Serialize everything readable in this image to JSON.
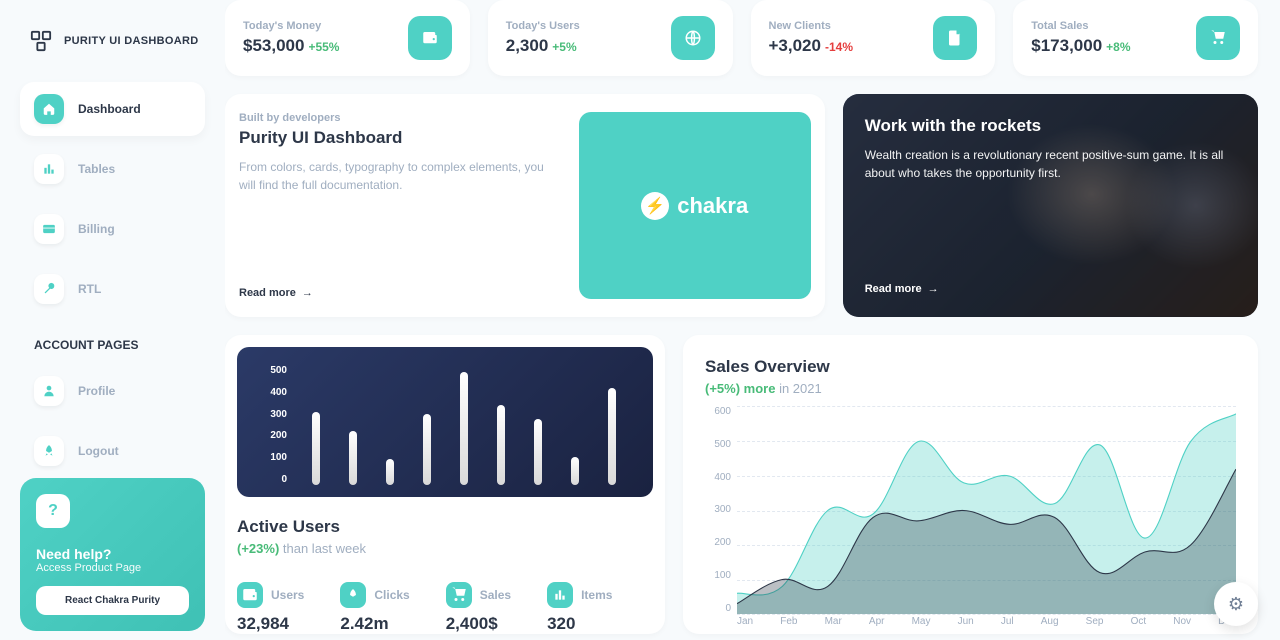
{
  "brand": "PURITY UI DASHBOARD",
  "nav": {
    "items": [
      {
        "label": "Dashboard",
        "icon": "home-icon"
      },
      {
        "label": "Tables",
        "icon": "stats-icon"
      },
      {
        "label": "Billing",
        "icon": "card-icon"
      },
      {
        "label": "RTL",
        "icon": "wrench-icon"
      }
    ],
    "account_heading": "ACCOUNT PAGES",
    "account_items": [
      {
        "label": "Profile",
        "icon": "person-icon"
      },
      {
        "label": "Logout",
        "icon": "rocket-icon"
      }
    ]
  },
  "help": {
    "title": "Need help?",
    "subtitle": "Access Product Page",
    "button": "React Chakra Purity"
  },
  "stats": [
    {
      "label": "Today's Money",
      "value": "$53,000",
      "delta": "+55%",
      "delta_sign": "pos",
      "icon": "wallet-icon"
    },
    {
      "label": "Today's Users",
      "value": "2,300",
      "delta": "+5%",
      "delta_sign": "pos",
      "icon": "globe-icon"
    },
    {
      "label": "New Clients",
      "value": "+3,020",
      "delta": "-14%",
      "delta_sign": "neg",
      "icon": "document-icon"
    },
    {
      "label": "Total Sales",
      "value": "$173,000",
      "delta": "+8%",
      "delta_sign": "pos",
      "icon": "cart-icon"
    }
  ],
  "intro": {
    "pre": "Built by developers",
    "title": "Purity UI Dashboard",
    "body": "From colors, cards, typography to complex elements, you will find the full documentation.",
    "read_more": "Read more",
    "brand_word": "chakra"
  },
  "rocket": {
    "title": "Work with the rockets",
    "body": "Wealth creation is a revolutionary recent positive-sum game. It is all about who takes the opportunity first.",
    "read_more": "Read more"
  },
  "active": {
    "title": "Active Users",
    "delta": "(+23%)",
    "subtitle_rest": " than last week",
    "mini": [
      {
        "label": "Users",
        "value": "32,984",
        "icon": "wallet-icon"
      },
      {
        "label": "Clicks",
        "value": "2.42m",
        "icon": "rocket-icon"
      },
      {
        "label": "Sales",
        "value": "2,400$",
        "icon": "cart-icon"
      },
      {
        "label": "Items",
        "value": "320",
        "icon": "stats-icon"
      }
    ]
  },
  "sales": {
    "title": "Sales Overview",
    "delta": "(+5%) more",
    "subtitle_rest": " in 2021"
  },
  "chart_data": [
    {
      "type": "bar",
      "values": [
        310,
        230,
        110,
        300,
        480,
        340,
        280,
        120,
        410
      ],
      "ylim": [
        0,
        500
      ],
      "y_ticks": [
        "500",
        "400",
        "300",
        "200",
        "100",
        "0"
      ]
    },
    {
      "type": "area",
      "x": [
        "Jan",
        "Feb",
        "Mar",
        "Apr",
        "May",
        "Jun",
        "Jul",
        "Aug",
        "Sep",
        "Oct",
        "Nov",
        "Dec"
      ],
      "series": [
        {
          "name": "teal",
          "color": "#4fd1c5",
          "values": [
            60,
            80,
            300,
            290,
            500,
            380,
            400,
            320,
            490,
            220,
            500,
            580
          ]
        },
        {
          "name": "dark",
          "color": "#2d3748",
          "values": [
            30,
            100,
            80,
            280,
            270,
            300,
            260,
            280,
            120,
            180,
            200,
            420
          ]
        }
      ],
      "ylim": [
        0,
        600
      ],
      "y_ticks": [
        "600",
        "500",
        "400",
        "300",
        "200",
        "100",
        "0"
      ]
    }
  ]
}
